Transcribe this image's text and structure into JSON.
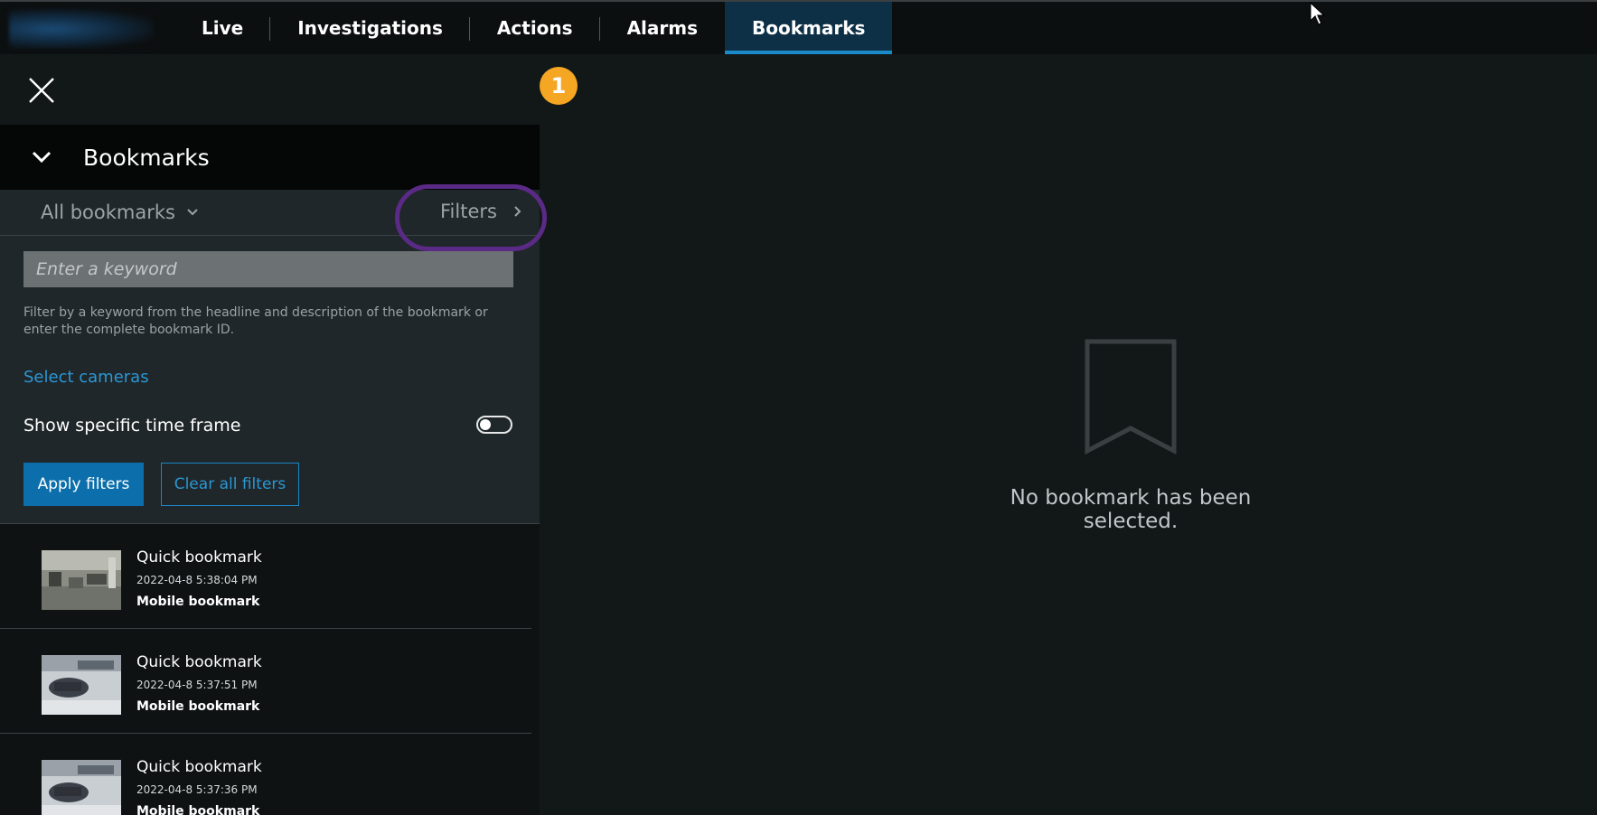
{
  "nav": {
    "tabs": [
      {
        "label": "Live"
      },
      {
        "label": "Investigations"
      },
      {
        "label": "Actions"
      },
      {
        "label": "Alarms"
      },
      {
        "label": "Bookmarks",
        "active": true
      }
    ]
  },
  "panel": {
    "title": "Bookmarks",
    "view_selector": "All bookmarks",
    "filters_label": "Filters",
    "callout_number": "1",
    "keyword_placeholder": "Enter a keyword",
    "keyword_help": "Filter by a keyword from the headline and description of the bookmark or enter the complete bookmark ID.",
    "select_cameras": "Select cameras",
    "time_frame_label": "Show specific time frame",
    "time_frame_enabled": false,
    "apply_label": "Apply filters",
    "clear_label": "Clear all filters"
  },
  "bookmarks": [
    {
      "title": "Quick bookmark",
      "date": "2022-04-8 5:38:04 PM",
      "camera": "Mobile bookmark"
    },
    {
      "title": "Quick bookmark",
      "date": "2022-04-8 5:37:51 PM",
      "camera": "Mobile bookmark"
    },
    {
      "title": "Quick bookmark",
      "date": "2022-04-8 5:37:36 PM",
      "camera": "Mobile bookmark"
    }
  ],
  "detail": {
    "empty_message": "No bookmark has been selected.",
    "icon": "bookmark-outline-icon"
  },
  "colors": {
    "accent": "#0c6fab",
    "link": "#2b97d4",
    "callout_badge": "#f5a623",
    "callout_ring": "#5b2a86"
  }
}
